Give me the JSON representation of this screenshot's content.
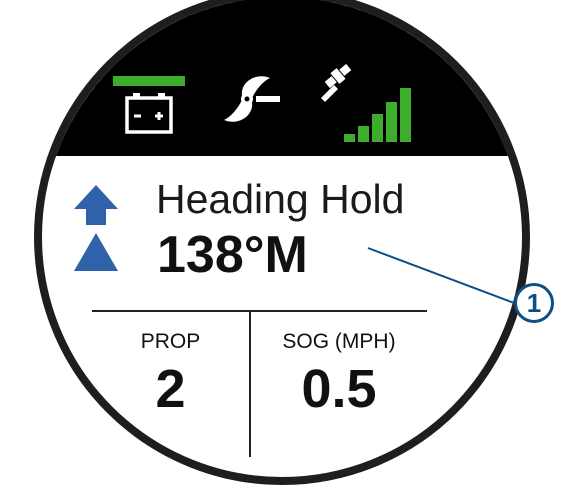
{
  "status_bar": {
    "icons": [
      "battery-icon",
      "propeller-icon",
      "gps-signal-icon"
    ],
    "accent_color": "#3dae2b"
  },
  "navigation": {
    "mode": "Heading Hold",
    "heading": "138°M",
    "heading_icon": "heading-arrow-icon",
    "icon_color": "#2f62a8"
  },
  "fields": [
    {
      "label": "PROP",
      "value": "2"
    },
    {
      "label": "SOG (MPH)",
      "value": "0.5"
    }
  ],
  "callouts": [
    {
      "number": "1",
      "color": "#0b4f86"
    }
  ]
}
